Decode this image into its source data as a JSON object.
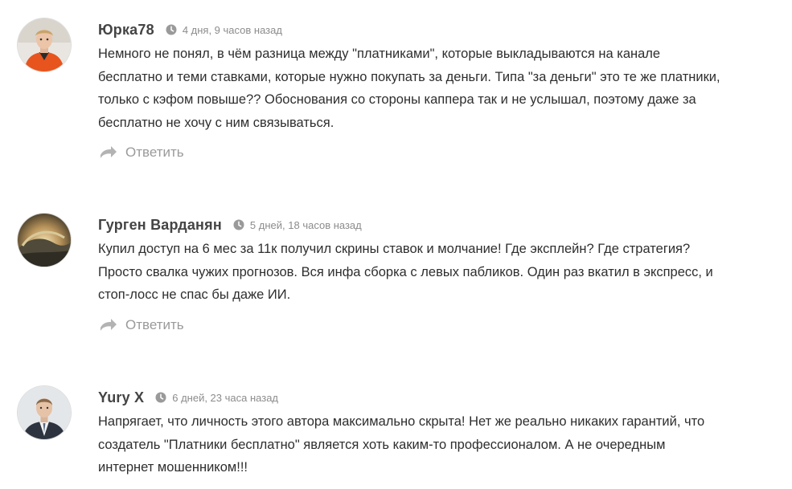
{
  "comments": [
    {
      "author": "Юрка78",
      "time": "4 дня, 9 часов назад",
      "lines": [
        "Немного не понял, в чём разница между \"платниками\", которые выкладываются на канале",
        "бесплатно и теми ставками, которые нужно покупать за деньги. Типа \"за деньги\" это те же платники,",
        "только с кэфом повыше?? Обоснования со стороны каппера так и не услышал, поэтому даже за",
        "бесплатно не хочу с ним связываться."
      ],
      "reply_label": "Ответить",
      "avatar_icon": "person-orange-jacket"
    },
    {
      "author": "Гурген Варданян",
      "time": "5 дней, 18 часов назад",
      "lines": [
        "Купил доступ на 6 мес за 11к получил скрины ставок и молчание! Где эксплейн? Где стратегия?",
        "Просто свалка чужих прогнозов. Вся инфа сборка с левых пабликов. Один раз вкатил в экспресс, и",
        "стоп-лосс не спас бы даже ИИ."
      ],
      "reply_label": "Ответить",
      "avatar_icon": "wave-photo"
    },
    {
      "author": "Yury X",
      "time": "6 дней, 23 часа назад",
      "lines": [
        "Напрягает, что личность этого автора максимально скрыта! Нет же реально никаких гарантий, что",
        "создатель \"Платники бесплатно\" является хоть каким-то профессионалом. А не очередным",
        "интернет мошенником!!!"
      ],
      "reply_label": "",
      "avatar_icon": "person-in-suit"
    }
  ],
  "colors": {
    "author": "#444444",
    "meta": "#8c8c8c",
    "text": "#2e2e2e",
    "reply": "#9a9a9a"
  }
}
